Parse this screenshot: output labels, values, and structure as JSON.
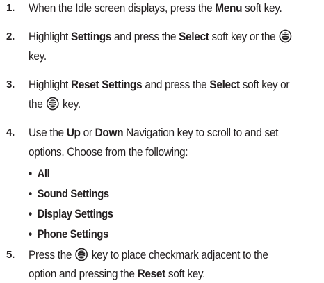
{
  "steps": [
    {
      "number": "1.",
      "lines": [
        [
          "When the Idle screen displays, press the ",
          "Menu",
          " soft key."
        ]
      ]
    },
    {
      "number": "2.",
      "lines": [
        [
          "Highlight ",
          "Settings",
          " and press the ",
          "Select",
          " soft key or the "
        ],
        [
          "key."
        ]
      ]
    },
    {
      "number": "3.",
      "lines": [
        [
          "Highlight ",
          "Reset Settings",
          " and press the ",
          "Select",
          " soft key or"
        ],
        [
          "the ",
          " key."
        ]
      ]
    },
    {
      "number": "4.",
      "lines": [
        [
          "Use the ",
          "Up",
          " or ",
          "Down",
          " Navigation key to scroll to and set"
        ],
        [
          "options. Choose from the following:"
        ]
      ]
    },
    {
      "number": "5.",
      "lines": [
        [
          "Press the ",
          " key to place checkmark adjacent to the"
        ],
        [
          "option and pressing the ",
          "Reset",
          " soft key."
        ]
      ]
    }
  ],
  "bullet_char": "•",
  "options": [
    "All",
    "Sound Settings",
    "Display Settings",
    "Phone Settings"
  ],
  "icon": "navigation-key-icon"
}
